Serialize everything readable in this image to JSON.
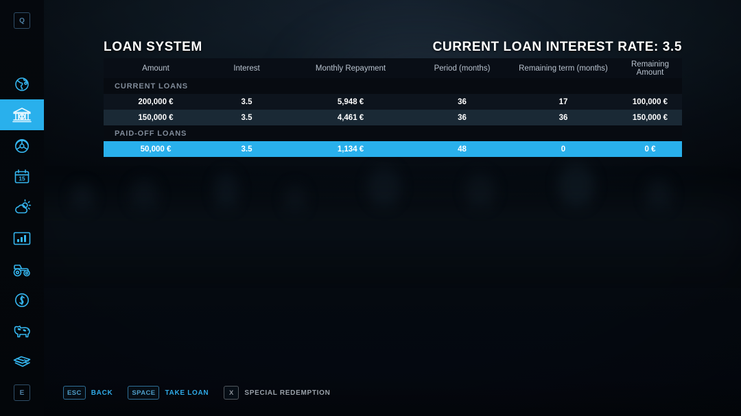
{
  "header": {
    "title": "LOAN SYSTEM",
    "interest_rate_label": "CURRENT LOAN INTEREST RATE: 3.5"
  },
  "colors": {
    "accent": "#29b0ec",
    "selected_row": "#29b0ec",
    "row_odd": "#0d141d",
    "row_even": "#1a2935",
    "header_row": "#090e16",
    "section_row": "#070b11",
    "text_primary": "#ffffff",
    "text_muted": "#808b99",
    "key_border": "#2f6f97",
    "key_disabled": "#52585e"
  },
  "sidebar": {
    "top_key": "Q",
    "bottom_key": "E",
    "items": [
      {
        "icon": "globe-icon",
        "label": "Map",
        "active": false
      },
      {
        "icon": "bank-icon",
        "label": "Finances",
        "active": true
      },
      {
        "icon": "steering-wheel-icon",
        "label": "Vehicles",
        "active": false
      },
      {
        "icon": "calendar-icon",
        "label": "Calendar",
        "active": false,
        "day": "15"
      },
      {
        "icon": "weather-icon",
        "label": "Weather",
        "active": false
      },
      {
        "icon": "statistics-icon",
        "label": "Statistics",
        "active": false
      },
      {
        "icon": "tractor-icon",
        "label": "Machines",
        "active": false
      },
      {
        "icon": "dollar-icon",
        "label": "Prices",
        "active": false
      },
      {
        "icon": "animal-icon",
        "label": "Animals",
        "active": false
      },
      {
        "icon": "contracts-icon",
        "label": "Contracts",
        "active": false
      }
    ]
  },
  "table": {
    "columns": [
      "Amount",
      "Interest",
      "Monthly Repayment",
      "Period (months)",
      "Remaining term (months)",
      "Remaining Amount"
    ],
    "sections": [
      {
        "label": "CURRENT LOANS",
        "rows": [
          {
            "selected": false,
            "cells": [
              "200,000 €",
              "3.5",
              "5,948 €",
              "36",
              "17",
              "100,000 €"
            ]
          },
          {
            "selected": false,
            "cells": [
              "150,000 €",
              "3.5",
              "4,461 €",
              "36",
              "36",
              "150,000 €"
            ]
          }
        ]
      },
      {
        "label": "PAID-OFF LOANS",
        "rows": [
          {
            "selected": true,
            "cells": [
              "50,000 €",
              "3.5",
              "1,134 €",
              "48",
              "0",
              "0 €"
            ]
          }
        ]
      }
    ]
  },
  "helpbar": {
    "items": [
      {
        "key": "ESC",
        "label": "BACK",
        "enabled": true
      },
      {
        "key": "SPACE",
        "label": "TAKE LOAN",
        "enabled": true
      },
      {
        "key": "X",
        "label": "SPECIAL REDEMPTION",
        "enabled": false
      }
    ]
  }
}
